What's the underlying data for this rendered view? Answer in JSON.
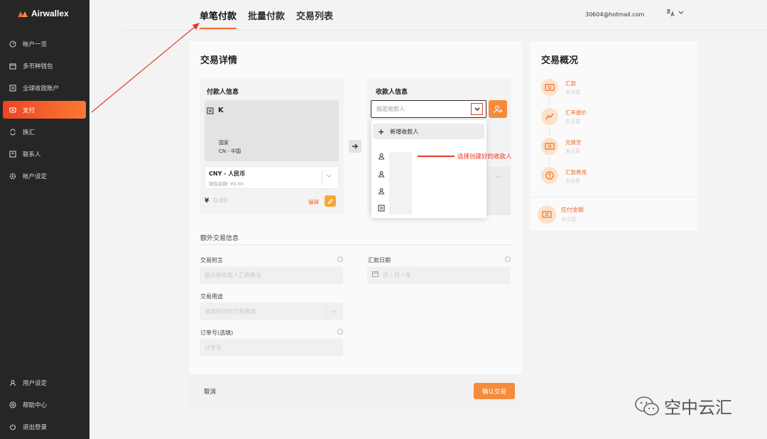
{
  "brand": {
    "name": "Airwallex",
    "accent": "#f26a2a"
  },
  "sidebar": {
    "items": [
      {
        "label": "帐户一览",
        "icon": "dashboard-icon"
      },
      {
        "label": "多币种钱包",
        "icon": "wallet-icon"
      },
      {
        "label": "全球收款账户",
        "icon": "bank-icon"
      },
      {
        "label": "支付",
        "icon": "payment-icon",
        "active": true
      },
      {
        "label": "换汇",
        "icon": "exchange-icon"
      },
      {
        "label": "联系人",
        "icon": "contacts-icon"
      },
      {
        "label": "帐户设定",
        "icon": "settings-icon"
      }
    ],
    "bottom_items": [
      {
        "label": "用户设定",
        "icon": "user-icon"
      },
      {
        "label": "帮助中心",
        "icon": "help-icon"
      },
      {
        "label": "退出登录",
        "icon": "logout-icon"
      }
    ]
  },
  "header": {
    "tabs": [
      {
        "label": "单笔付款",
        "active": true
      },
      {
        "label": "批量付款"
      },
      {
        "label": "交易列表"
      }
    ],
    "email": "30604@hotmail.com"
  },
  "main": {
    "title": "交易详情",
    "payer": {
      "section_label": "付款人信息",
      "name": "K",
      "country_label": "国家",
      "country_value": "CN - 中国",
      "currency": "CNY - 人民币",
      "balance": "钱包余额: ¥0.00",
      "currency_symbol": "¥",
      "amount": "0.00",
      "edit_label": "编辑"
    },
    "payee": {
      "section_label": "收款人信息",
      "placeholder": "指定收款人",
      "dropdown_new": "新增收款人"
    },
    "annotation": "选择创建好的收款人",
    "extra": {
      "title": "额外交易信息",
      "remark_label": "交易附言",
      "remark_placeholder": "展示给收款人汇款备注",
      "date_label": "汇款日期",
      "date_placeholder": "日 / 月 / 年",
      "purpose_label": "交易用途",
      "purpose_placeholder": "请选择您的交易用途",
      "order_label": "订单号(选填)",
      "order_placeholder": "订单号"
    },
    "cancel_label": "取消",
    "confirm_label": "确认交易"
  },
  "overview": {
    "title": "交易概况",
    "items": [
      {
        "label": "汇款",
        "sub": "未设置",
        "icon": "money-icon"
      },
      {
        "label": "汇率报价",
        "sub": "未设置",
        "icon": "trend-icon"
      },
      {
        "label": "兑换至",
        "sub": "未设置",
        "icon": "money-icon"
      },
      {
        "label": "汇款费用",
        "sub": "未设置",
        "icon": "coin-icon"
      }
    ],
    "payable_label": "应付金额",
    "payable_sub": "未设置"
  },
  "watermark": "空中云汇"
}
